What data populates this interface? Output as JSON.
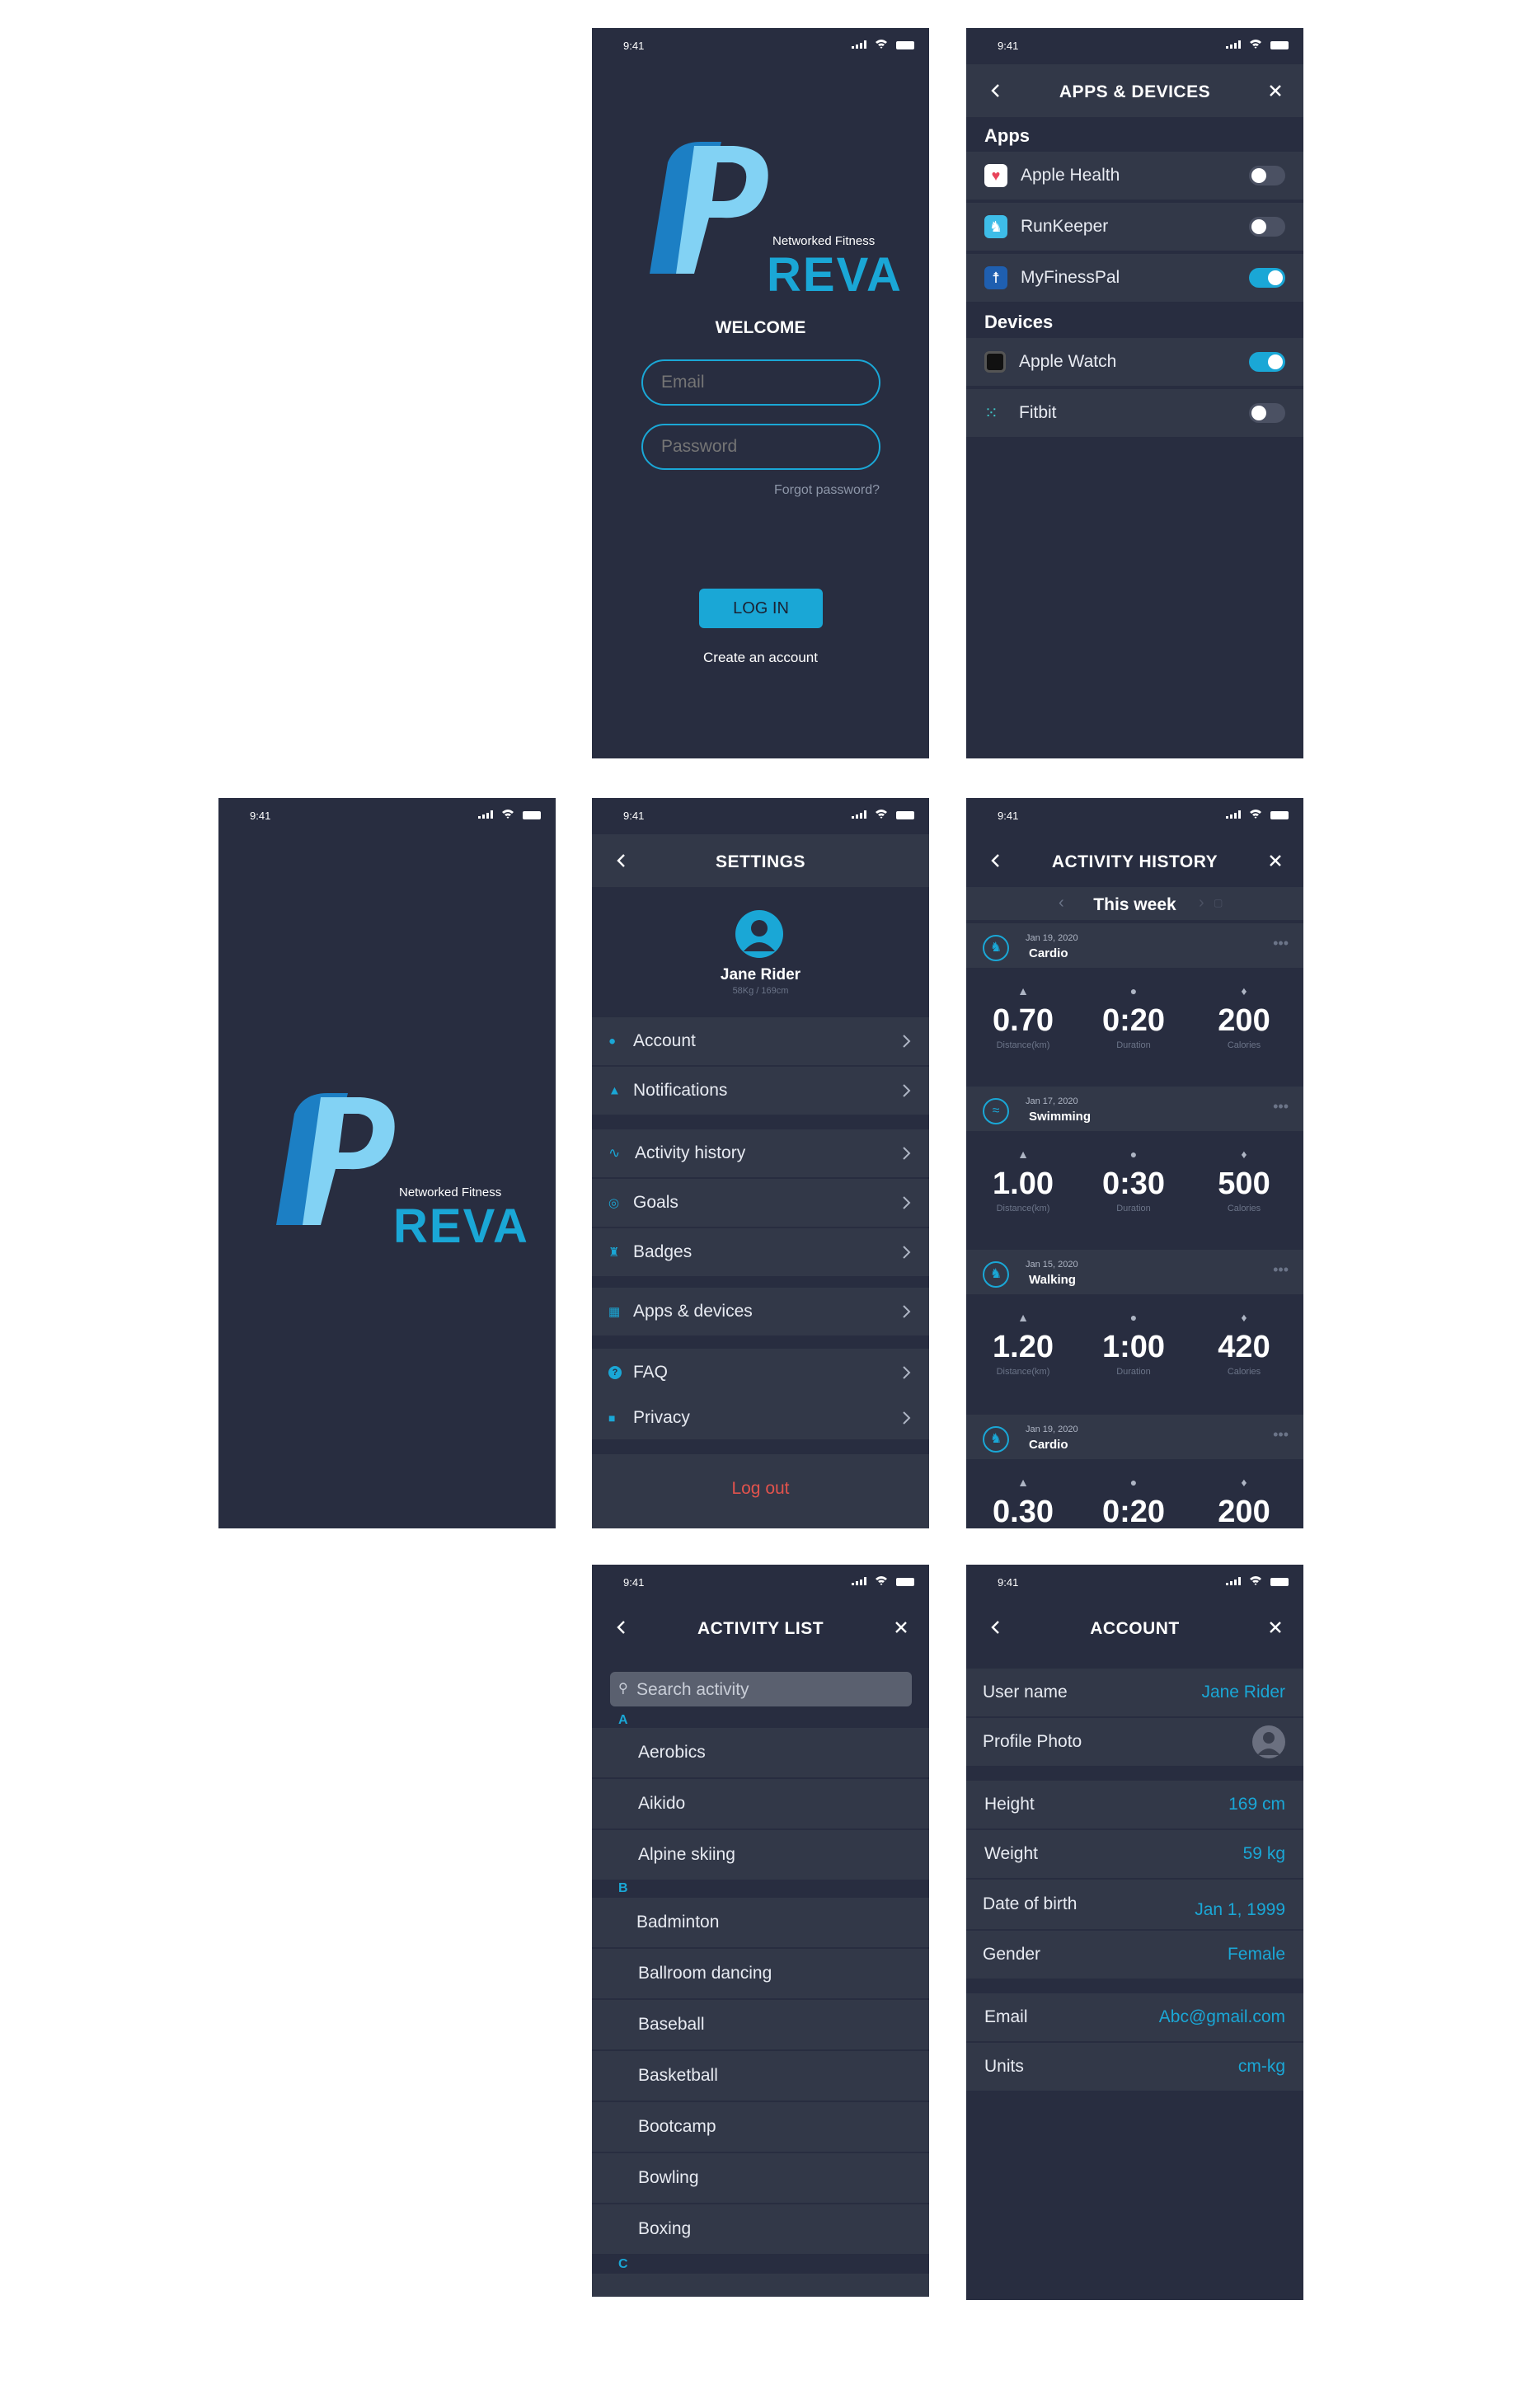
{
  "status_time": "9:41",
  "colors": {
    "accent": "#1aa7d6",
    "bg": "#282d40",
    "row": "#323848",
    "danger": "#e2534d"
  },
  "login": {
    "brand_tagline": "Networked Fitness",
    "brand_name": "REVA",
    "welcome": "WELCOME",
    "email_placeholder": "Email",
    "password_placeholder": "Password",
    "forgot": "Forgot password?",
    "login_button": "LOG IN",
    "create_account": "Create an account"
  },
  "apps_devices": {
    "title": "APPS & DEVICES",
    "apps_heading": "Apps",
    "apps": [
      {
        "name": "Apple Health",
        "on": false,
        "icon": "heart-icon"
      },
      {
        "name": "RunKeeper",
        "on": false,
        "icon": "runner-icon"
      },
      {
        "name": "MyFinessPal",
        "on": true,
        "icon": "fitness-icon"
      }
    ],
    "devices_heading": "Devices",
    "devices": [
      {
        "name": "Apple Watch",
        "on": true,
        "icon": "watch-icon"
      },
      {
        "name": "Fitbit",
        "on": false,
        "icon": "fitbit-icon"
      }
    ]
  },
  "splash": {
    "brand_tagline": "Networked Fitness",
    "brand_name": "REVA"
  },
  "settings": {
    "title": "SETTINGS",
    "user_name": "Jane Rider",
    "user_stats": "58Kg / 169cm",
    "items": [
      "Account",
      "Notifications",
      "Activity history",
      "Goals",
      "Badges",
      "Apps & devices",
      "FAQ",
      "Privacy"
    ],
    "logout": "Log out"
  },
  "activity_history": {
    "title": "ACTIVITY HISTORY",
    "period": "This week",
    "entries": [
      {
        "date": "Jan 19, 2020",
        "type": "Cardio",
        "distance": "0.70",
        "duration": "0:20",
        "calories": "200"
      },
      {
        "date": "Jan 17, 2020",
        "type": "Swimming",
        "distance": "1.00",
        "duration": "0:30",
        "calories": "500"
      },
      {
        "date": "Jan 15, 2020",
        "type": "Walking",
        "distance": "1.20",
        "duration": "1:00",
        "calories": "420"
      },
      {
        "date": "Jan 19, 2020",
        "type": "Cardio",
        "distance": "0.30",
        "duration": "0:20",
        "calories": "200"
      }
    ],
    "labels": {
      "distance": "Distance(km)",
      "duration": "Duration",
      "calories": "Calories"
    }
  },
  "activity_list": {
    "title": "ACTIVITY LIST",
    "search_placeholder": "Search activity",
    "groups": [
      {
        "letter": "A",
        "items": [
          "Aerobics",
          "Aikido",
          "Alpine skiing"
        ]
      },
      {
        "letter": "B",
        "items": [
          "Badminton",
          "Ballroom dancing",
          "Baseball",
          "Basketball",
          "Bootcamp",
          "Bowling",
          "Boxing"
        ]
      },
      {
        "letter": "C",
        "items": []
      }
    ]
  },
  "account": {
    "title": "ACCOUNT",
    "rows": [
      {
        "label": "User name",
        "value": "Jane Rider"
      },
      {
        "label": "Profile Photo",
        "value": ""
      },
      {
        "label": "Height",
        "value": "169 cm"
      },
      {
        "label": "Weight",
        "value": "59 kg"
      },
      {
        "label": "Date of birth",
        "value": "Jan 1, 1999"
      },
      {
        "label": "Gender",
        "value": "Female"
      },
      {
        "label": "Email",
        "value": "Abc@gmail.com"
      },
      {
        "label": "Units",
        "value": "cm-kg"
      }
    ]
  }
}
